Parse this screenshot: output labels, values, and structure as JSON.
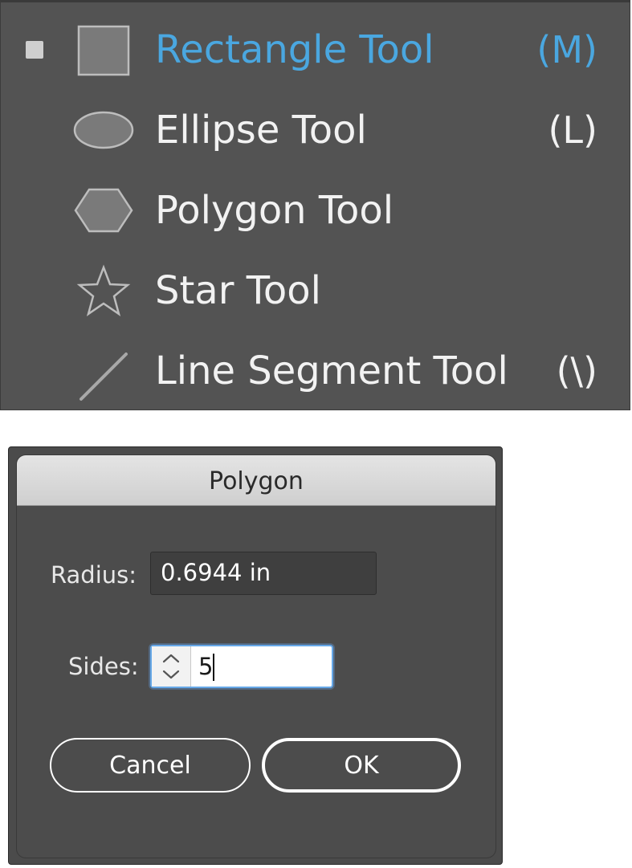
{
  "tool_menu": {
    "items": [
      {
        "label": "Rectangle Tool",
        "shortcut": "(M)",
        "icon": "rectangle-icon",
        "active": true
      },
      {
        "label": "Ellipse Tool",
        "shortcut": "(L)",
        "icon": "ellipse-icon",
        "active": false
      },
      {
        "label": "Polygon Tool",
        "shortcut": "",
        "icon": "polygon-icon",
        "active": false
      },
      {
        "label": "Star Tool",
        "shortcut": "",
        "icon": "star-icon",
        "active": false
      },
      {
        "label": "Line Segment Tool",
        "shortcut": "(\\)",
        "icon": "line-segment-icon",
        "active": false
      }
    ],
    "colors": {
      "background": "#535353",
      "active_text": "#4aa7e0",
      "text": "#f2f2f2"
    }
  },
  "dialog": {
    "title": "Polygon",
    "radius": {
      "label": "Radius:",
      "value": "0.6944 in"
    },
    "sides": {
      "label": "Sides:",
      "value": "5"
    },
    "buttons": {
      "cancel": "Cancel",
      "ok": "OK"
    }
  }
}
